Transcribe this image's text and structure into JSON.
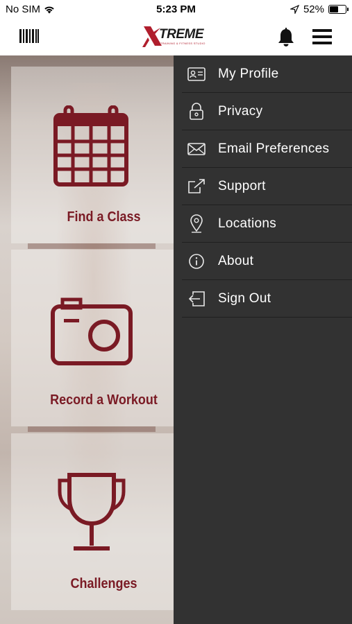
{
  "status_bar": {
    "carrier": "No SIM",
    "time": "5:23 PM",
    "battery_percent": "52%",
    "battery_level": 0.52
  },
  "header": {
    "logo_text": "TREME",
    "logo_letter": "X",
    "logo_tagline": "TRAINING & FITNESS STUDIO",
    "brand_color": "#b01e2d"
  },
  "tiles": [
    {
      "label": "Find a Class",
      "icon": "calendar-icon"
    },
    {
      "label": "Record a Workout",
      "icon": "camera-icon"
    },
    {
      "label": "Challenges",
      "icon": "trophy-icon"
    }
  ],
  "menu": {
    "items": [
      {
        "label": "My Profile",
        "icon": "profile-card-icon"
      },
      {
        "label": "Privacy",
        "icon": "lock-icon"
      },
      {
        "label": "Email Preferences",
        "icon": "envelope-icon"
      },
      {
        "label": "Support",
        "icon": "external-link-icon"
      },
      {
        "label": "Locations",
        "icon": "map-pin-icon"
      },
      {
        "label": "About",
        "icon": "info-icon"
      },
      {
        "label": "Sign Out",
        "icon": "sign-out-icon"
      }
    ]
  },
  "colors": {
    "accent": "#7a1a24",
    "drawer_bg": "#323232"
  }
}
